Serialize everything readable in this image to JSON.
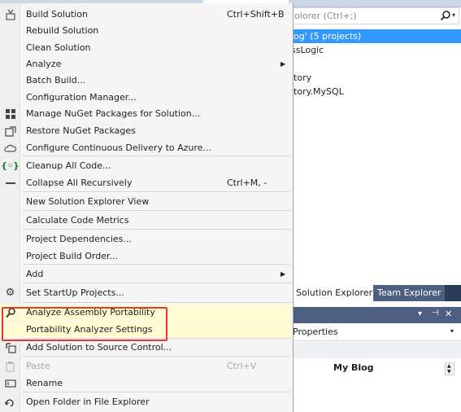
{
  "solution_explorer": {
    "search_placeholder": "olorer (Ctrl+;)",
    "tree": {
      "solution": "log' (5 projects)",
      "bll": "ssLogic",
      "repo": "itory",
      "repo_mysql": "itory.MySQL"
    },
    "tabs": {
      "solution_explorer": "Solution Explorer",
      "team_explorer": "Team Explorer"
    }
  },
  "properties": {
    "select_label": "Properties",
    "title": "My Blog",
    "header_buttons": {
      "dropdown": "▾",
      "pin": "⊣",
      "close": "✕"
    }
  },
  "menu": {
    "items": [
      {
        "label": "Build Solution",
        "shortcut": "Ctrl+Shift+B",
        "icon": "build-icon"
      },
      {
        "label": "Rebuild Solution"
      },
      {
        "label": "Clean Solution"
      },
      {
        "label": "Analyze",
        "submenu": true
      },
      {
        "label": "Batch Build..."
      },
      {
        "label": "Configuration Manager..."
      },
      {
        "label": "Manage NuGet Packages for Solution...",
        "icon": "nuget-icon"
      },
      {
        "label": "Restore NuGet Packages",
        "icon": "restore-icon"
      },
      {
        "label": "Configure Continuous Delivery to Azure...",
        "icon": "cloud-icon"
      },
      {
        "label": "Cleanup All Code...",
        "icon": "code-cleanup-icon"
      },
      {
        "label": "Collapse All Recursively",
        "shortcut": "Ctrl+M, -",
        "icon": "collapse-icon"
      },
      {
        "label": "New Solution Explorer View"
      },
      {
        "label": "Calculate Code Metrics"
      },
      {
        "label": "Project Dependencies..."
      },
      {
        "label": "Project Build Order..."
      },
      {
        "label": "Add",
        "submenu": true
      },
      {
        "label": "Set StartUp Projects...",
        "icon": "gear-icon"
      },
      {
        "label": "Analyze Assembly Portability",
        "icon": "portability-icon"
      },
      {
        "label": "Portability Analyzer Settings"
      },
      {
        "label": "Add Solution to Source Control...",
        "icon": "source-control-icon"
      },
      {
        "label": "Paste",
        "shortcut": "Ctrl+V",
        "icon": "paste-icon",
        "disabled": true
      },
      {
        "label": "Rename",
        "icon": "rename-icon"
      },
      {
        "label": "Open Folder in File Explorer",
        "icon": "open-folder-icon"
      }
    ]
  },
  "colors": {
    "selection": "#3399ff",
    "highlight_box": "#e53935",
    "menu_bg": "#f5f5f5"
  }
}
